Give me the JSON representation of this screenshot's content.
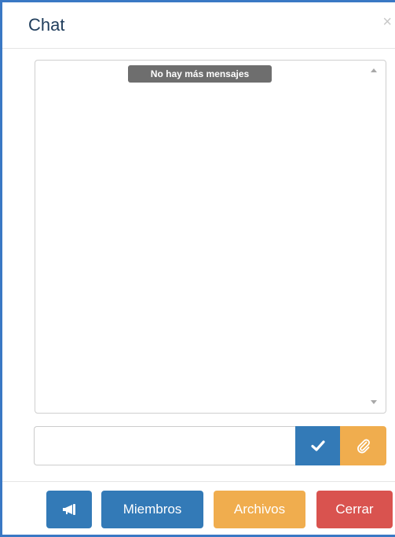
{
  "window": {
    "title": "Chat",
    "close_glyph": "×"
  },
  "messages": {
    "notice": "No hay más mensajes"
  },
  "composer": {
    "input_value": "",
    "send_icon": "check-icon",
    "attach_icon": "paperclip-icon"
  },
  "footer": {
    "announce_icon": "megaphone-icon",
    "members_label": "Miembros",
    "files_label": "Archivos",
    "close_label": "Cerrar"
  },
  "colors": {
    "primary": "#337ab7",
    "warning": "#f0ad4e",
    "danger": "#d9534f",
    "frame_border": "#3a78c4"
  }
}
